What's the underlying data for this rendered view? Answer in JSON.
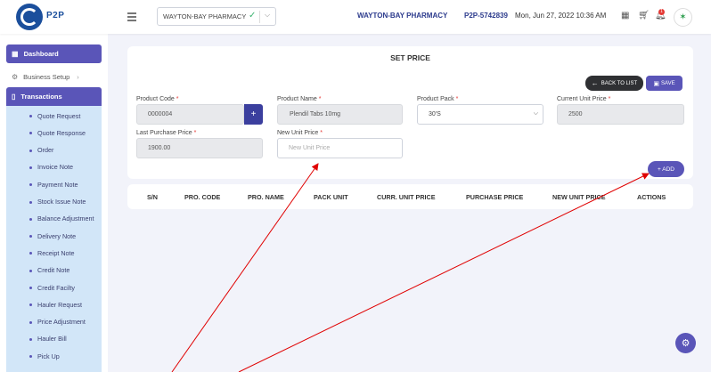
{
  "header": {
    "logo_text": "P2P",
    "pharmacy_select": "WAYTON-BAY PHARMACY",
    "pharmacy_name": "WAYTON-BAY PHARMACY",
    "user_id": "P2P-5742839",
    "datetime": "Mon, Jun 27, 2022 10:36 AM",
    "notification_count": "1"
  },
  "sidebar": {
    "dashboard": "Dashboard",
    "business_setup": "Business Setup",
    "transactions": "Transactions",
    "sub_items": [
      "Quote Request",
      "Quote Response",
      "Order",
      "Invoice Note",
      "Payment Note",
      "Stock Issue Note",
      "Balance Adjustment",
      "Delivery Note",
      "Receipt Note",
      "Credit Note",
      "Credit Facilty",
      "Hauler Request",
      "Price Adjustment",
      "Hauler Bill",
      "Pick Up"
    ]
  },
  "form": {
    "title": "SET PRICE",
    "back_label": "BACK TO LIST",
    "save_label": "SAVE",
    "add_label": "+ ADD",
    "product_code_label": "Product Code",
    "product_code_value": "0000004",
    "product_name_label": "Product Name",
    "product_name_value": "Plendil Tabs 10mg",
    "product_pack_label": "Product Pack",
    "product_pack_value": "30'S",
    "current_price_label": "Current Unit Price",
    "current_price_value": "2500",
    "last_purchase_label": "Last Purchase Price",
    "last_purchase_value": "1900.00",
    "new_price_label": "New Unit Price",
    "new_price_placeholder": "New Unit Price",
    "required_mark": "*"
  },
  "table": {
    "columns": [
      "S/N",
      "PRO. CODE",
      "PRO. NAME",
      "PACK UNIT",
      "CURR. UNIT PRICE",
      "PURCHASE PRICE",
      "NEW UNIT PRICE",
      "ACTIONS"
    ]
  },
  "colors": {
    "accent": "#5a55b8",
    "brand": "#1b4f9c",
    "submenu_bg": "#d2e6f8",
    "annotation": "#e00000"
  }
}
